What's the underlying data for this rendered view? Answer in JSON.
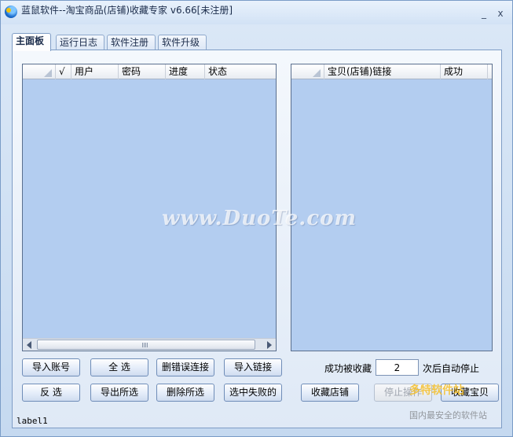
{
  "window": {
    "title": "蓝鼠软件--淘宝商品(店铺)收藏专家 v6.66[未注册]",
    "minimize_label": "_",
    "close_label": "x"
  },
  "tabs": [
    {
      "label": "主面板",
      "active": true
    },
    {
      "label": "运行日志",
      "active": false
    },
    {
      "label": "软件注册",
      "active": false
    },
    {
      "label": "软件升级",
      "active": false
    }
  ],
  "accounts_list": {
    "columns": [
      "",
      "√",
      "用户",
      "密码",
      "进度",
      "状态"
    ],
    "rows": []
  },
  "links_list": {
    "columns": [
      "",
      "宝贝(店铺)链接",
      "成功"
    ],
    "rows": []
  },
  "buttons": {
    "import_accounts": "导入账号",
    "select_all": "全 选",
    "delete_error_links": "删错误连接",
    "import_links": "导入链接",
    "invert_selection": "反 选",
    "export_selected": "导出所选",
    "delete_selected": "删除所选",
    "select_failed": "选中失败的",
    "favorite_shop": "收藏店铺",
    "stop_operation": "停止操作",
    "favorite_item": "收藏宝贝"
  },
  "auto_stop": {
    "prefix": "成功被收藏",
    "count": "2",
    "suffix": "次后自动停止"
  },
  "status_label": "label1",
  "watermark": {
    "main": "www.DuoTe.com",
    "corner_top": "多特软件站",
    "corner_bottom": "国内最安全的软件站"
  },
  "colors": {
    "list_background": "#b3cdf0",
    "panel_background": "#dfe9f6",
    "button_border": "#6f8db8"
  }
}
